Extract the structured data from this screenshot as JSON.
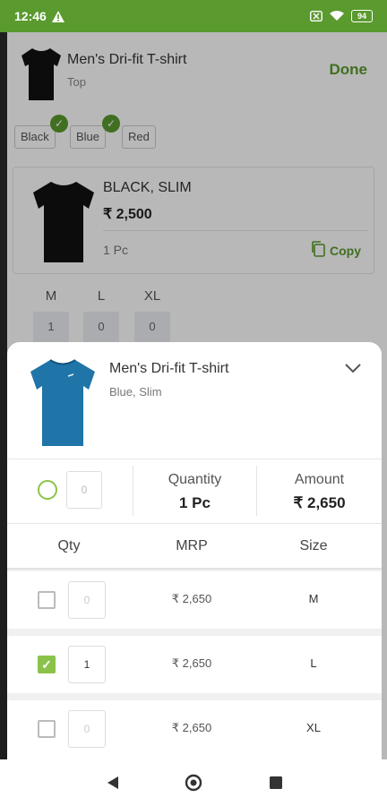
{
  "status_bar": {
    "time": "12:46",
    "battery": "94"
  },
  "background": {
    "product_title": "Men's Dri-fit T-shirt",
    "product_subtitle": "Top",
    "done_label": "Done",
    "color_chips": [
      "Black",
      "Blue",
      "Red"
    ],
    "variant": {
      "name": "BLACK, SLIM",
      "price": "₹ 2,500",
      "quantity": "1 Pc",
      "copy_label": "Copy"
    },
    "sizes": [
      {
        "label": "M",
        "value": "1"
      },
      {
        "label": "L",
        "value": "0"
      },
      {
        "label": "XL",
        "value": "0"
      }
    ]
  },
  "sheet": {
    "title": "Men's Dri-fit T-shirt",
    "subtitle": "Blue, Slim",
    "summary": {
      "input_value": "0",
      "quantity_label": "Quantity",
      "quantity_value": "1 Pc",
      "amount_label": "Amount",
      "amount_value": "₹ 2,650"
    },
    "columns": [
      "Qty",
      "MRP",
      "Size"
    ],
    "rows": [
      {
        "checked": false,
        "qty": "0",
        "mrp": "₹ 2,650",
        "size": "M"
      },
      {
        "checked": true,
        "qty": "1",
        "mrp": "₹ 2,650",
        "size": "L"
      },
      {
        "checked": false,
        "qty": "0",
        "mrp": "₹ 2,650",
        "size": "XL"
      }
    ]
  },
  "colors": {
    "accent": "#5a9a2e",
    "check": "#8bc34a",
    "black_shirt": "#111111",
    "blue_shirt": "#1f74a8"
  },
  "icons": [
    "warning-icon",
    "x-box-icon",
    "wifi-icon",
    "battery-icon",
    "check-icon",
    "copy-icon",
    "chevron-down-icon",
    "back-icon",
    "home-icon",
    "recents-icon"
  ]
}
